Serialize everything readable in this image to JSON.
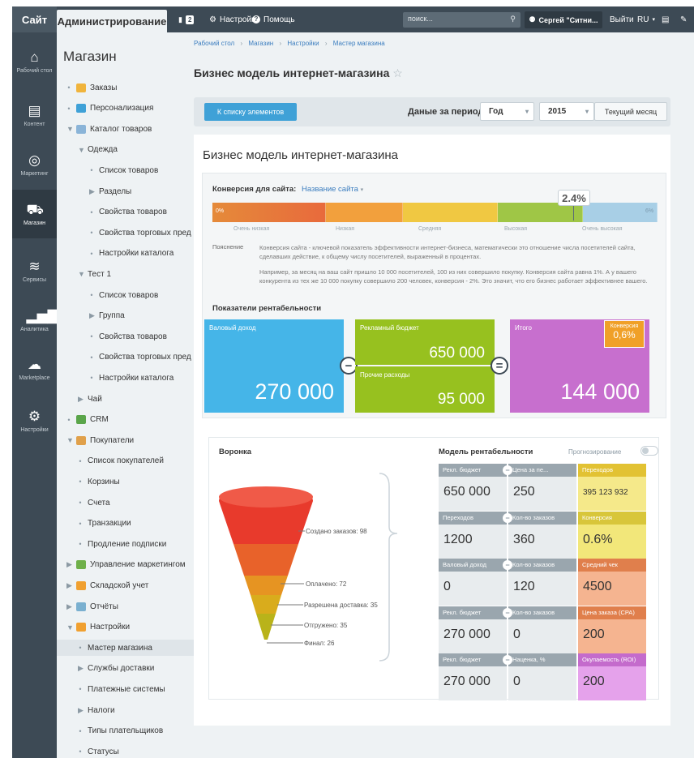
{
  "topbar": {
    "site": "Сайт",
    "admin": "Администрирование",
    "notif_count": "2",
    "settings": "Настройки",
    "help": "Помощь",
    "search_placeholder": "поиск...",
    "user": "Сергей \"Ситни...",
    "logout": "Выйти",
    "lang": "RU"
  },
  "leftnav": [
    {
      "label": "Рабочий стол",
      "icon": "home-icon"
    },
    {
      "label": "Контент",
      "icon": "document-icon"
    },
    {
      "label": "Маркетинг",
      "icon": "target-icon"
    },
    {
      "label": "Магазин",
      "icon": "basket-icon"
    },
    {
      "label": "Сервисы",
      "icon": "layers-icon"
    },
    {
      "label": "Аналитика",
      "icon": "analytics-icon"
    },
    {
      "label": "Marketplace",
      "icon": "cloud-download-icon"
    },
    {
      "label": "Настройки",
      "icon": "gear-icon"
    }
  ],
  "tree": {
    "title": "Магазин",
    "items": [
      {
        "label": "Заказы",
        "level": 0,
        "marker": "■",
        "icon_color": "#f0b43c"
      },
      {
        "label": "Персонализация",
        "level": 0,
        "marker": "■",
        "icon_color": "#3fa1d7"
      },
      {
        "label": "Каталог товаров",
        "level": 0,
        "marker": "▼",
        "icon_color": "#8ab4d8"
      },
      {
        "label": "Одежда",
        "level": 1,
        "marker": "▼"
      },
      {
        "label": "Список товаров",
        "level": 2,
        "marker": "■"
      },
      {
        "label": "Разделы",
        "level": 2,
        "marker": "▶"
      },
      {
        "label": "Свойства товаров",
        "level": 2,
        "marker": "■"
      },
      {
        "label": "Свойства торговых пред",
        "level": 2,
        "marker": "■"
      },
      {
        "label": "Настройки каталога",
        "level": 2,
        "marker": "■"
      },
      {
        "label": "Тест 1",
        "level": 1,
        "marker": "▼"
      },
      {
        "label": "Список товаров",
        "level": 2,
        "marker": "■"
      },
      {
        "label": "Группа",
        "level": 2,
        "marker": "▶"
      },
      {
        "label": "Свойства товаров",
        "level": 2,
        "marker": "■"
      },
      {
        "label": "Свойства торговых пред",
        "level": 2,
        "marker": "■"
      },
      {
        "label": "Настройки каталога",
        "level": 2,
        "marker": "■"
      },
      {
        "label": "Чай",
        "level": 1,
        "marker": "▶"
      },
      {
        "label": "CRM",
        "level": 0,
        "marker": "■",
        "icon_color": "#5aa54a"
      },
      {
        "label": "Покупатели",
        "level": 0,
        "marker": "▼",
        "icon_color": "#e0a04a"
      },
      {
        "label": "Список покупателей",
        "level": 1,
        "marker": "■"
      },
      {
        "label": "Корзины",
        "level": 1,
        "marker": "■"
      },
      {
        "label": "Счета",
        "level": 1,
        "marker": "■"
      },
      {
        "label": "Транзакции",
        "level": 1,
        "marker": "■"
      },
      {
        "label": "Продление подписки",
        "level": 1,
        "marker": "■"
      },
      {
        "label": "Управление маркетингом",
        "level": 0,
        "marker": "▶",
        "icon_color": "#6fb04a"
      },
      {
        "label": "Складской учет",
        "level": 0,
        "marker": "▶",
        "icon_color": "#f0a030"
      },
      {
        "label": "Отчёты",
        "level": 0,
        "marker": "▶",
        "icon_color": "#7ab0d0"
      },
      {
        "label": "Настройки",
        "level": 0,
        "marker": "▼",
        "icon_color": "#f0a030"
      },
      {
        "label": "Мастер магазина",
        "level": 1,
        "marker": "■",
        "selected": true
      },
      {
        "label": "Службы доставки",
        "level": 1,
        "marker": "▶"
      },
      {
        "label": "Платежные системы",
        "level": 1,
        "marker": "■"
      },
      {
        "label": "Налоги",
        "level": 1,
        "marker": "▶"
      },
      {
        "label": "Типы плательщиков",
        "level": 1,
        "marker": "■"
      },
      {
        "label": "Статусы",
        "level": 1,
        "marker": "■"
      }
    ]
  },
  "breadcrumb": [
    "Рабочий стол",
    "Магазин",
    "Настройки",
    "Мастер магазина"
  ],
  "page_title": "Бизнес модель интернет-магазина",
  "toolbar": {
    "back_button": "К списку элементов",
    "period_label": "Даные за период:",
    "period_value": "Год",
    "year_value": "2015",
    "current_month": "Текущий месяц"
  },
  "card": {
    "title": "Бизнес модель интернет-магазина",
    "conversion_label": "Конверсия для сайта:",
    "site_name": "Название сайта",
    "conversion_value": "2.4%",
    "scale_start": "0%",
    "scale_end": "6%",
    "scale_labels": [
      "Очень низкая",
      "Низкая",
      "Средняя",
      "Высокая",
      "Очень высокая"
    ],
    "explanation_label": "Пояснение",
    "explanation_1": "Конверсия сайта - ключевой показатель эффективности интернет-бизнеса, математически это отношение числа посетителей сайта, сделавших действие, к общему числу посетителей, выраженный в процентах.",
    "explanation_2": "Например, за месяц на ваш сайт пришло 10 000 посетителей, 100 из них совершило покупку. Конверсия сайта равна 1%. А у вашего конкурента из тех же 10 000 покупку совершило 200 человек, конверсия - 2%. Это значит, что его бизнес работает эффективнее вашего.",
    "profit_title": "Показатели рентабельности",
    "gross_label": "Валовый доход",
    "gross_value": "270 000",
    "ad_budget_label": "Рекламный бюджет",
    "ad_budget_value": "650 000",
    "other_label": "Прочие расходы",
    "other_value": "95 000",
    "total_label": "Итого",
    "total_value": "144 000",
    "conv_badge_label": "Конверсия",
    "conv_badge_value": "0,6%",
    "minus": "−",
    "equals": "="
  },
  "funnel": {
    "title": "Воронка",
    "labels": [
      "Создано заказов: 98",
      "Оплачено: 72",
      "Разрешена доставка: 35",
      "Отгружено: 35",
      "Финал: 26"
    ],
    "values": [
      98,
      72,
      35,
      35,
      26
    ]
  },
  "model": {
    "title": "Модель рентабельности",
    "forecast": "Прогнозирование",
    "rows": [
      {
        "h": [
          "Рекл. бюджет",
          "Цена за пе...",
          "Переходов"
        ],
        "v": [
          "650 000",
          "250",
          "395 123 932"
        ]
      },
      {
        "h": [
          "Переходов",
          "Кол-во заказов",
          "Конверсия"
        ],
        "v": [
          "1200",
          "360",
          "0.6%"
        ]
      },
      {
        "h": [
          "Валовый доход",
          "Кол-во заказов",
          "Средний чек"
        ],
        "v": [
          "0",
          "120",
          "4500"
        ]
      },
      {
        "h": [
          "Рекл. бюджет",
          "Кол-во заказов",
          "Цена заказа (CPA)"
        ],
        "v": [
          "270 000",
          "0",
          "200"
        ]
      },
      {
        "h": [
          "Рекл. бюджет",
          "Наценка, %",
          "Окупаемость (ROI)"
        ],
        "v": [
          "270 000",
          "0",
          "200"
        ]
      }
    ],
    "result_colors": [
      {
        "head": "#e2c233",
        "body": "#f5e98a"
      },
      {
        "head": "#d8c63a",
        "body": "#f2e77a"
      },
      {
        "head": "#e07f4c",
        "body": "#f5b490"
      },
      {
        "head": "#e07f4c",
        "body": "#f5b490"
      },
      {
        "head": "#c46bcc",
        "body": "#e5a2eb"
      }
    ]
  },
  "colors": {
    "accent_blue": "#3fa1d7",
    "tile_blue": "#45b5e8",
    "tile_green": "#97c11f",
    "tile_purple": "#c76fce",
    "badge_orange": "#f0a028"
  }
}
